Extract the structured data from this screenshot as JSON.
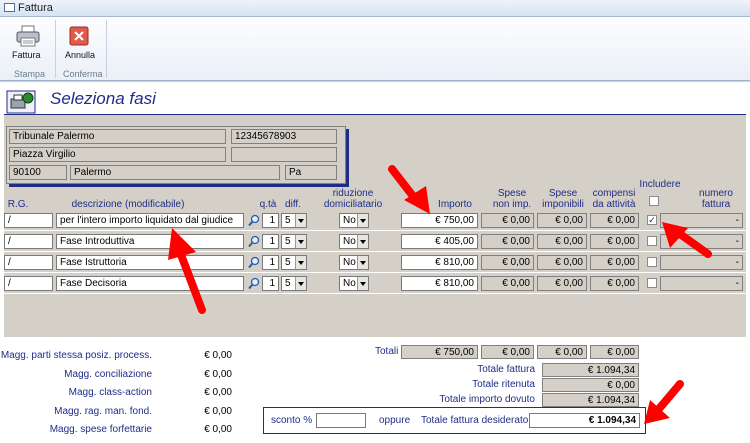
{
  "window": {
    "title": "Fattura"
  },
  "ribbon": {
    "fattura_label": "Fattura",
    "annulla_label": "Annulla",
    "group_stampa": "Stampa",
    "group_conferma": "Conferma"
  },
  "header": {
    "title": "Seleziona fasi"
  },
  "address": {
    "name": "Tribunale Palermo",
    "code": "12345678903",
    "street": "Piazza Virgilio",
    "extra": "",
    "cap": "90100",
    "city": "Palermo",
    "prov": "Pa"
  },
  "columns": {
    "rg": "R.G.",
    "descrizione": "descrizione (modificabile)",
    "qta": "q.tà",
    "diff": "diff.",
    "riduzione": "riduzione domiciliatario",
    "importo": "Importo",
    "spese_non_imp": "Spese non imp.",
    "spese_imp": "Spese imponibili",
    "compensi": "compensi da attività",
    "includere": "Includere",
    "numero": "numero fattura"
  },
  "rows": [
    {
      "rg": "/",
      "desc": "per l'intero importo liquidato dal giudice",
      "qta": "1",
      "diff": "5",
      "rid": "No",
      "importo": "€ 750,00",
      "snimp": "€ 0,00",
      "simp": "€ 0,00",
      "comp": "€ 0,00",
      "incl": "✓",
      "num": "-"
    },
    {
      "rg": "/",
      "desc": "Fase Introduttiva",
      "qta": "1",
      "diff": "5",
      "rid": "No",
      "importo": "€ 405,00",
      "snimp": "€ 0,00",
      "simp": "€ 0,00",
      "comp": "€ 0,00",
      "incl": "",
      "num": "-"
    },
    {
      "rg": "/",
      "desc": "Fase Istruttoria",
      "qta": "1",
      "diff": "5",
      "rid": "No",
      "importo": "€ 810,00",
      "snimp": "€ 0,00",
      "simp": "€ 0,00",
      "comp": "€ 0,00",
      "incl": "",
      "num": "-"
    },
    {
      "rg": "/",
      "desc": "Fase Decisoria",
      "qta": "1",
      "diff": "5",
      "rid": "No",
      "importo": "€ 810,00",
      "snimp": "€ 0,00",
      "simp": "€ 0,00",
      "comp": "€ 0,00",
      "incl": "",
      "num": "-"
    }
  ],
  "left_summary": [
    {
      "label": "Magg. parti stessa posiz. process.",
      "value": "€ 0,00"
    },
    {
      "label": "Magg. conciliazione",
      "value": "€ 0,00"
    },
    {
      "label": "Magg. class-action",
      "value": "€ 0,00"
    },
    {
      "label": "Magg. rag. man. fond.",
      "value": "€ 0,00"
    },
    {
      "label": "Magg. spese forfettarie",
      "value": "€ 0,00"
    }
  ],
  "totali": {
    "label": "Totali",
    "importo": "€ 750,00",
    "snimp": "€ 0,00",
    "simp": "€ 0,00",
    "comp": "€ 0,00"
  },
  "totals_right": [
    {
      "label": "Totale fattura",
      "value": "€ 1.094,34"
    },
    {
      "label": "Totale ritenuta",
      "value": "€ 0,00"
    },
    {
      "label": "Totale importo dovuto",
      "value": "€ 1.094,34"
    }
  ],
  "footer": {
    "sconto_label": "sconto %",
    "sconto_value": "",
    "oppure_label": "oppure",
    "desiderato_label": "Totale fattura desiderato",
    "desiderato_value": "€ 1.094,34"
  },
  "colors": {
    "accent": "#1f2d87",
    "arrow": "#ff0000"
  }
}
